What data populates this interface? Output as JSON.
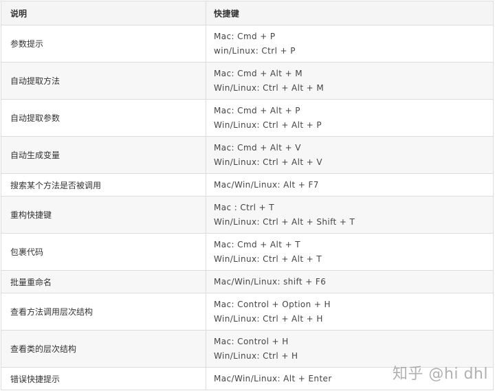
{
  "table": {
    "headers": [
      "说明",
      "快捷键"
    ],
    "rows": [
      {
        "desc": "参数提示",
        "keys": [
          "Mac: Cmd + P",
          "win/Linux: Ctrl + P"
        ]
      },
      {
        "desc": "自动提取方法",
        "keys": [
          "Mac: Cmd + Alt + M",
          "Win/Linux: Ctrl + Alt + M"
        ]
      },
      {
        "desc": "自动提取参数",
        "keys": [
          "Mac: Cmd + Alt + P",
          "Win/Linux: Ctrl + Alt + P"
        ]
      },
      {
        "desc": "自动生成变量",
        "keys": [
          "Mac: Cmd + Alt + V",
          "Win/Linux: Ctrl + Alt + V"
        ]
      },
      {
        "desc": "搜索某个方法是否被调用",
        "keys": [
          "Mac/Win/Linux: Alt + F7"
        ]
      },
      {
        "desc": "重构快捷键",
        "keys": [
          "Mac : Ctrl + T",
          "Win/Linux: Ctrl + Alt + Shift + T"
        ]
      },
      {
        "desc": "包裹代码",
        "keys": [
          "Mac: Cmd + Alt + T",
          "Win/Linux: Ctrl + Alt + T"
        ]
      },
      {
        "desc": "批量重命名",
        "keys": [
          "Mac/Win/Linux: shift + F6"
        ]
      },
      {
        "desc": "查看方法调用层次结构",
        "keys": [
          "Mac: Control + Option + H",
          "Win/Linux: Ctrl + Alt + H"
        ]
      },
      {
        "desc": "查看类的层次结构",
        "keys": [
          "Mac: Control + H",
          "Win/Linux: Ctrl + H"
        ]
      },
      {
        "desc": "错误快捷提示",
        "keys": [
          "Mac/Win/Linux: Alt + Enter"
        ]
      }
    ]
  },
  "watermark": "知乎 @hi dhl"
}
